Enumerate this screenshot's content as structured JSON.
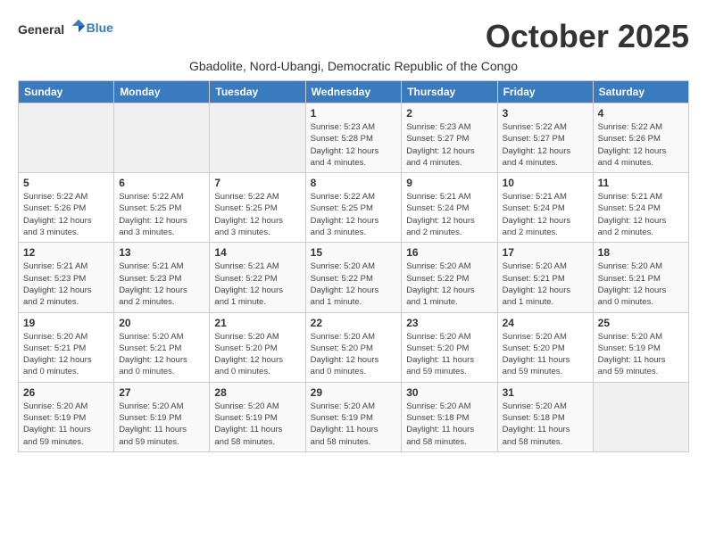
{
  "logo": {
    "text_general": "General",
    "text_blue": "Blue"
  },
  "month_title": "October 2025",
  "subtitle": "Gbadolite, Nord-Ubangi, Democratic Republic of the Congo",
  "weekdays": [
    "Sunday",
    "Monday",
    "Tuesday",
    "Wednesday",
    "Thursday",
    "Friday",
    "Saturday"
  ],
  "weeks": [
    [
      {
        "day": "",
        "info": ""
      },
      {
        "day": "",
        "info": ""
      },
      {
        "day": "",
        "info": ""
      },
      {
        "day": "1",
        "info": "Sunrise: 5:23 AM\nSunset: 5:28 PM\nDaylight: 12 hours\nand 4 minutes."
      },
      {
        "day": "2",
        "info": "Sunrise: 5:23 AM\nSunset: 5:27 PM\nDaylight: 12 hours\nand 4 minutes."
      },
      {
        "day": "3",
        "info": "Sunrise: 5:22 AM\nSunset: 5:27 PM\nDaylight: 12 hours\nand 4 minutes."
      },
      {
        "day": "4",
        "info": "Sunrise: 5:22 AM\nSunset: 5:26 PM\nDaylight: 12 hours\nand 4 minutes."
      }
    ],
    [
      {
        "day": "5",
        "info": "Sunrise: 5:22 AM\nSunset: 5:26 PM\nDaylight: 12 hours\nand 3 minutes."
      },
      {
        "day": "6",
        "info": "Sunrise: 5:22 AM\nSunset: 5:25 PM\nDaylight: 12 hours\nand 3 minutes."
      },
      {
        "day": "7",
        "info": "Sunrise: 5:22 AM\nSunset: 5:25 PM\nDaylight: 12 hours\nand 3 minutes."
      },
      {
        "day": "8",
        "info": "Sunrise: 5:22 AM\nSunset: 5:25 PM\nDaylight: 12 hours\nand 3 minutes."
      },
      {
        "day": "9",
        "info": "Sunrise: 5:21 AM\nSunset: 5:24 PM\nDaylight: 12 hours\nand 2 minutes."
      },
      {
        "day": "10",
        "info": "Sunrise: 5:21 AM\nSunset: 5:24 PM\nDaylight: 12 hours\nand 2 minutes."
      },
      {
        "day": "11",
        "info": "Sunrise: 5:21 AM\nSunset: 5:24 PM\nDaylight: 12 hours\nand 2 minutes."
      }
    ],
    [
      {
        "day": "12",
        "info": "Sunrise: 5:21 AM\nSunset: 5:23 PM\nDaylight: 12 hours\nand 2 minutes."
      },
      {
        "day": "13",
        "info": "Sunrise: 5:21 AM\nSunset: 5:23 PM\nDaylight: 12 hours\nand 2 minutes."
      },
      {
        "day": "14",
        "info": "Sunrise: 5:21 AM\nSunset: 5:22 PM\nDaylight: 12 hours\nand 1 minute."
      },
      {
        "day": "15",
        "info": "Sunrise: 5:20 AM\nSunset: 5:22 PM\nDaylight: 12 hours\nand 1 minute."
      },
      {
        "day": "16",
        "info": "Sunrise: 5:20 AM\nSunset: 5:22 PM\nDaylight: 12 hours\nand 1 minute."
      },
      {
        "day": "17",
        "info": "Sunrise: 5:20 AM\nSunset: 5:21 PM\nDaylight: 12 hours\nand 1 minute."
      },
      {
        "day": "18",
        "info": "Sunrise: 5:20 AM\nSunset: 5:21 PM\nDaylight: 12 hours\nand 0 minutes."
      }
    ],
    [
      {
        "day": "19",
        "info": "Sunrise: 5:20 AM\nSunset: 5:21 PM\nDaylight: 12 hours\nand 0 minutes."
      },
      {
        "day": "20",
        "info": "Sunrise: 5:20 AM\nSunset: 5:21 PM\nDaylight: 12 hours\nand 0 minutes."
      },
      {
        "day": "21",
        "info": "Sunrise: 5:20 AM\nSunset: 5:20 PM\nDaylight: 12 hours\nand 0 minutes."
      },
      {
        "day": "22",
        "info": "Sunrise: 5:20 AM\nSunset: 5:20 PM\nDaylight: 12 hours\nand 0 minutes."
      },
      {
        "day": "23",
        "info": "Sunrise: 5:20 AM\nSunset: 5:20 PM\nDaylight: 11 hours\nand 59 minutes."
      },
      {
        "day": "24",
        "info": "Sunrise: 5:20 AM\nSunset: 5:20 PM\nDaylight: 11 hours\nand 59 minutes."
      },
      {
        "day": "25",
        "info": "Sunrise: 5:20 AM\nSunset: 5:19 PM\nDaylight: 11 hours\nand 59 minutes."
      }
    ],
    [
      {
        "day": "26",
        "info": "Sunrise: 5:20 AM\nSunset: 5:19 PM\nDaylight: 11 hours\nand 59 minutes."
      },
      {
        "day": "27",
        "info": "Sunrise: 5:20 AM\nSunset: 5:19 PM\nDaylight: 11 hours\nand 59 minutes."
      },
      {
        "day": "28",
        "info": "Sunrise: 5:20 AM\nSunset: 5:19 PM\nDaylight: 11 hours\nand 58 minutes."
      },
      {
        "day": "29",
        "info": "Sunrise: 5:20 AM\nSunset: 5:19 PM\nDaylight: 11 hours\nand 58 minutes."
      },
      {
        "day": "30",
        "info": "Sunrise: 5:20 AM\nSunset: 5:18 PM\nDaylight: 11 hours\nand 58 minutes."
      },
      {
        "day": "31",
        "info": "Sunrise: 5:20 AM\nSunset: 5:18 PM\nDaylight: 11 hours\nand 58 minutes."
      },
      {
        "day": "",
        "info": ""
      }
    ]
  ]
}
